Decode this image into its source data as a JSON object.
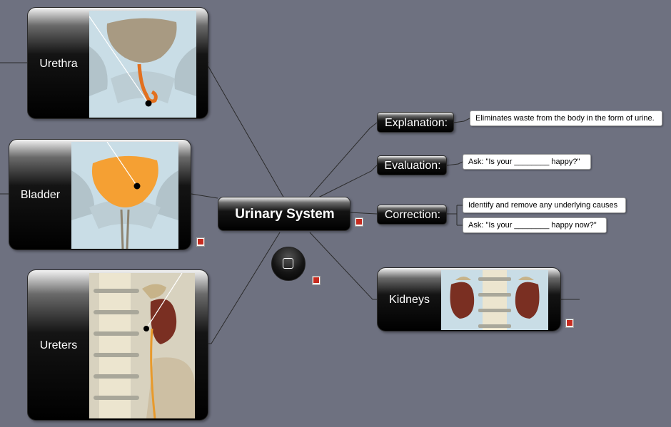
{
  "map": {
    "central": {
      "label": "Urinary System"
    },
    "branches": [
      {
        "label": "Urethra",
        "picture": "urethra-illustration"
      },
      {
        "label": "Bladder",
        "picture": "bladder-illustration"
      },
      {
        "label": "Ureters",
        "picture": "ureters-illustration"
      },
      {
        "label": "Kidneys",
        "picture": "kidneys-illustration"
      }
    ],
    "topics": [
      {
        "label": "Explanation:",
        "notes": [
          "Eliminates waste from the body in the form of urine."
        ]
      },
      {
        "label": "Evaluation:",
        "notes": [
          "Ask: \"Is your ________ happy?\""
        ]
      },
      {
        "label": "Correction:",
        "notes": [
          "Identify and remove any underlying causes",
          "Ask: \"Is your  ________ happy now?\""
        ]
      }
    ]
  },
  "icons": {
    "note": "note-icon",
    "floating_topic": "rounded-square-icon"
  },
  "colors": {
    "canvas": "#6e7180",
    "node_fill": "#000000",
    "node_text": "#ffffff",
    "link": "#2b2b2b",
    "note_icon_red": "#c62b1f",
    "organ_orange": "#f5a033",
    "kidney_brown": "#7a2f22"
  }
}
